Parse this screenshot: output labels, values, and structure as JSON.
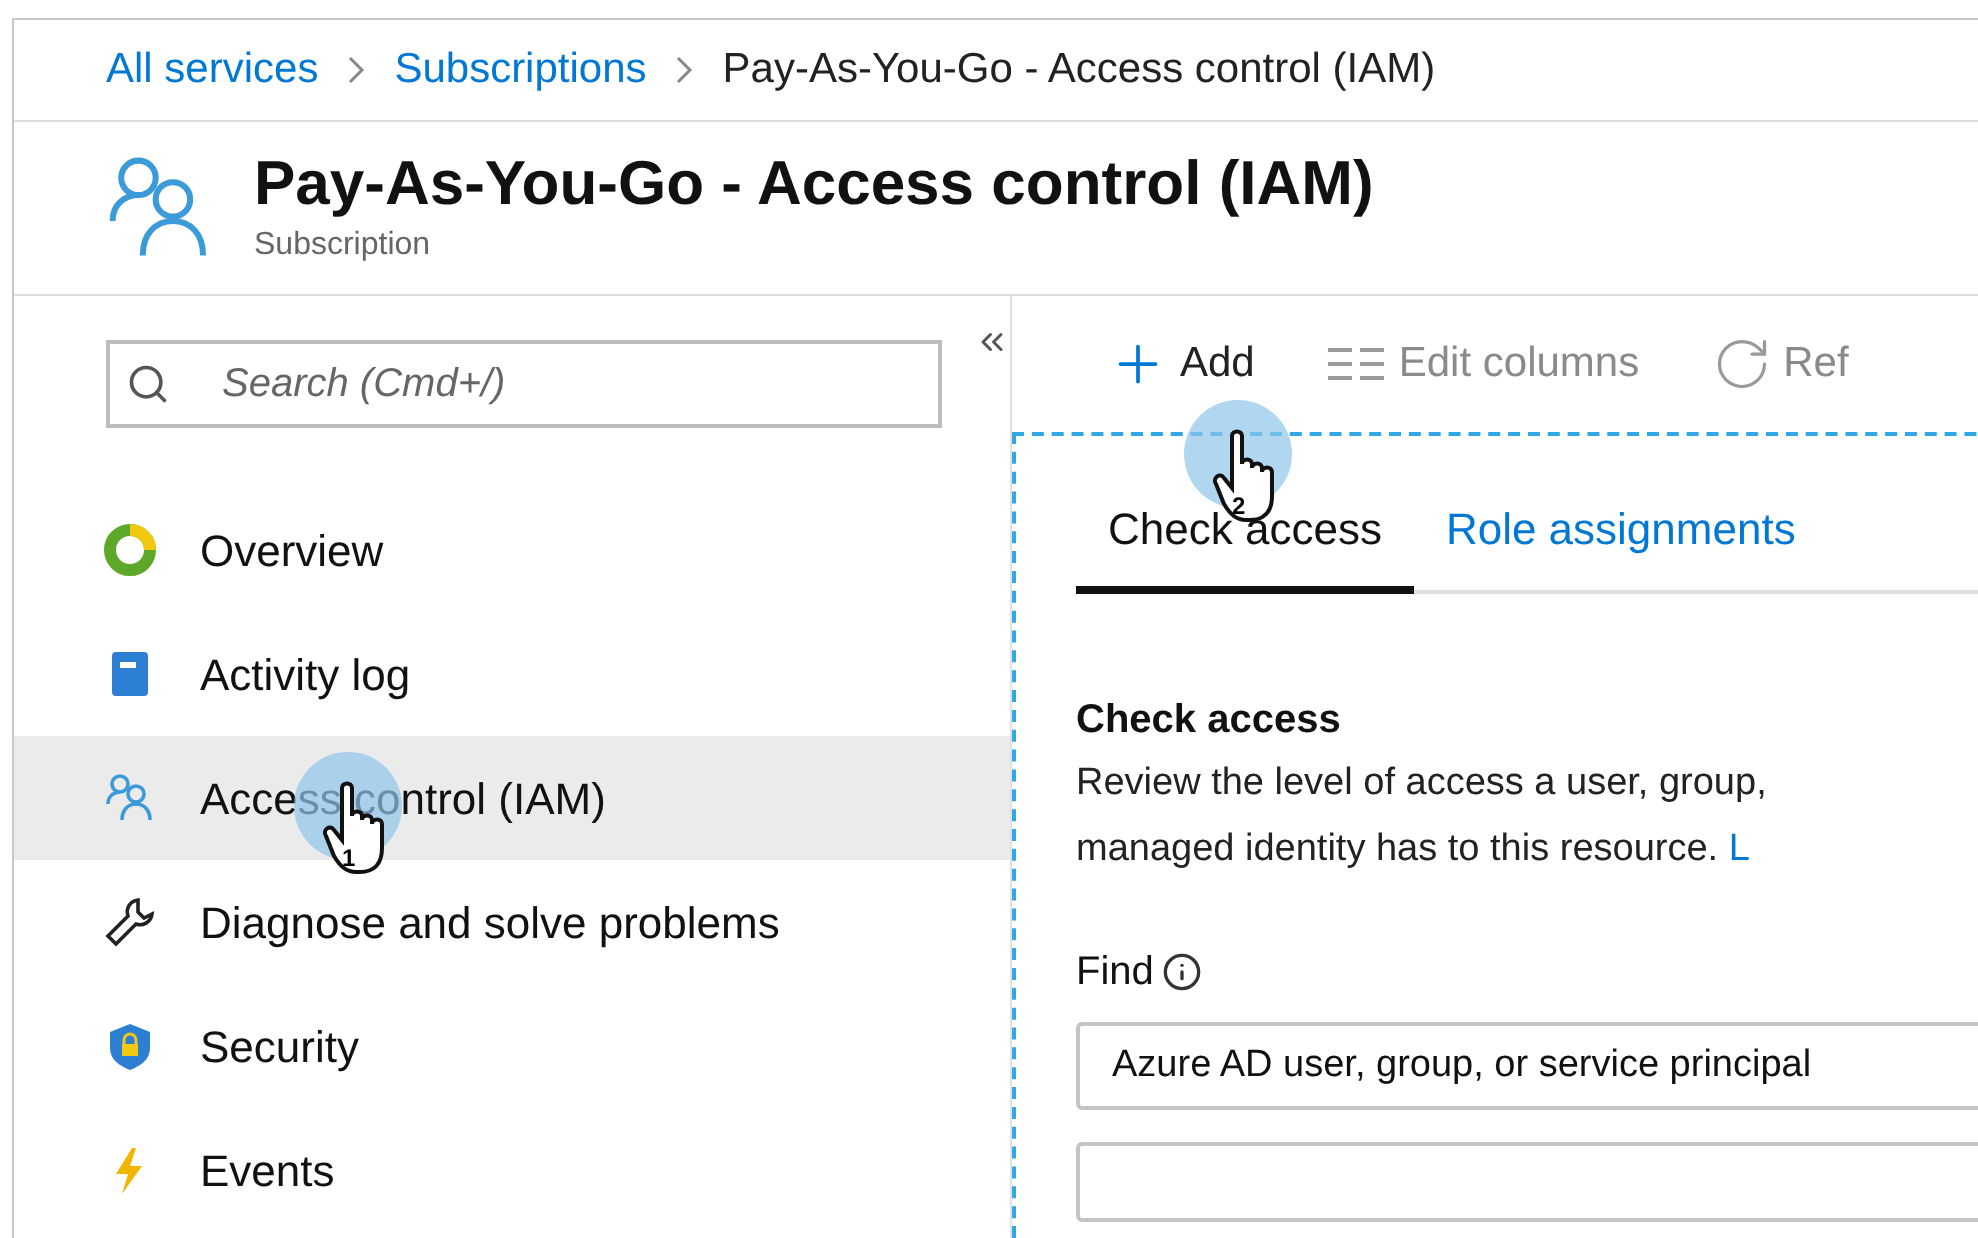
{
  "breadcrumb": [
    {
      "label": "All services",
      "kind": "link"
    },
    {
      "label": "Subscriptions",
      "kind": "link"
    },
    {
      "label": "Pay-As-You-Go - Access control (IAM)",
      "kind": "current"
    }
  ],
  "header": {
    "title": "Pay-As-You-Go - Access control (IAM)",
    "subtitle": "Subscription"
  },
  "sidebar": {
    "search": {
      "placeholder": "Search (Cmd+/)"
    },
    "items": [
      {
        "label": "Overview",
        "selected": false
      },
      {
        "label": "Activity log",
        "selected": false
      },
      {
        "label": "Access control (IAM)",
        "selected": true
      },
      {
        "label": "Diagnose and solve problems",
        "selected": false
      },
      {
        "label": "Security",
        "selected": false
      },
      {
        "label": "Events",
        "selected": false
      }
    ]
  },
  "toolbar": [
    {
      "label": "Add",
      "kind": "add"
    },
    {
      "label": "Edit columns",
      "kind": "columns"
    },
    {
      "label": "Ref",
      "kind": "refresh"
    }
  ],
  "tabs": [
    {
      "label": "Check access",
      "selected": true
    },
    {
      "label": "Role assignments",
      "selected": false
    }
  ],
  "section": {
    "heading": "Check access",
    "lines": [
      "Review the level of access a user, group,",
      "managed identity has to this resource."
    ],
    "link": "L"
  },
  "find": {
    "label": "Find",
    "value": "Azure AD user, group, or service principal"
  },
  "callouts": [
    {
      "number": "1"
    },
    {
      "number": "2"
    }
  ]
}
